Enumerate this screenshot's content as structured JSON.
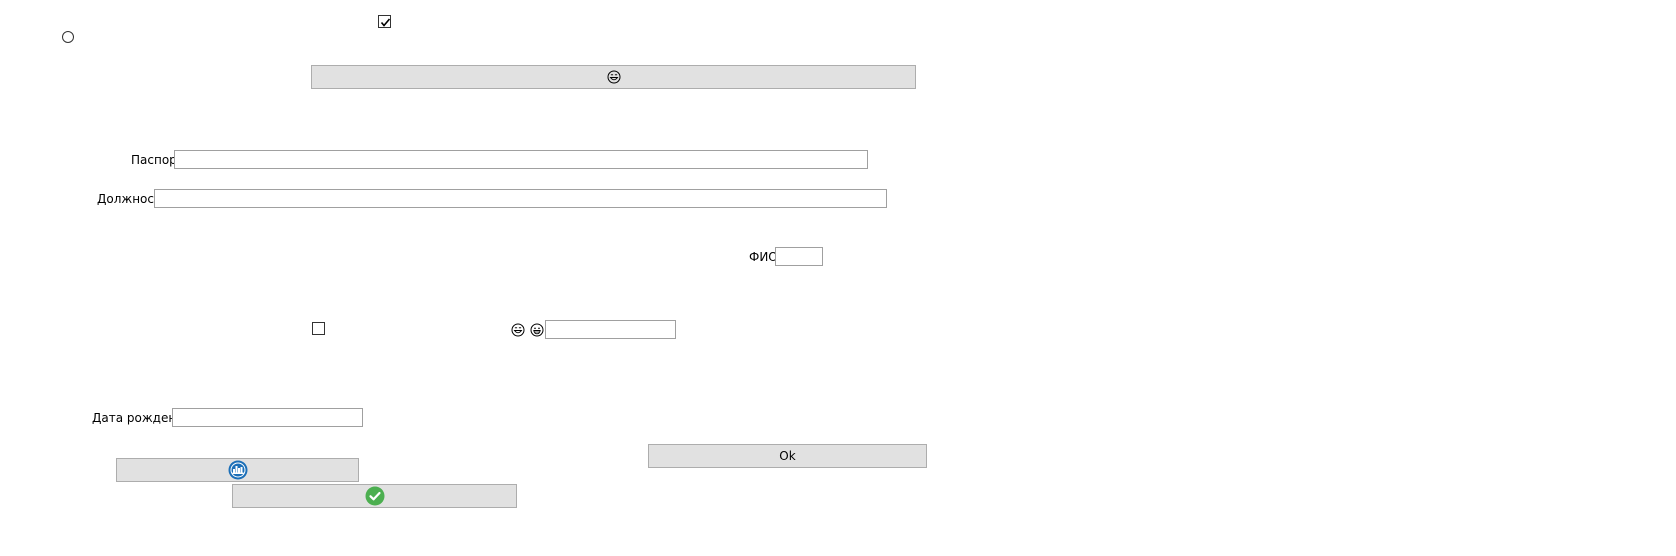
{
  "form": {
    "checkbox_top_checked": true,
    "radio_checked": false,
    "checkbox_mid_checked": false,
    "passport_label": "Паспорт",
    "passport_value": "",
    "position_label": "Должность",
    "position_value": "",
    "fio_label": "ФИО",
    "fio_value": "",
    "small_field_value": "",
    "birthdate_label": "Дата рождения",
    "birthdate_value": "",
    "ok_button_label": "Ok"
  },
  "icons": {
    "wide_button_icon": "grinning-face-icon",
    "emoji_left": "grinning-face-icon",
    "emoji_right": "smiling-face-icon",
    "blue_button_icon": "city-skyline-icon",
    "green_button_icon": "check-circle-icon"
  },
  "colors": {
    "button_bg": "#e1e1e1",
    "button_border": "#adadad",
    "field_border": "#a0a0a0",
    "blue_icon": "#1b6fb8",
    "green_icon": "#4caf50"
  }
}
